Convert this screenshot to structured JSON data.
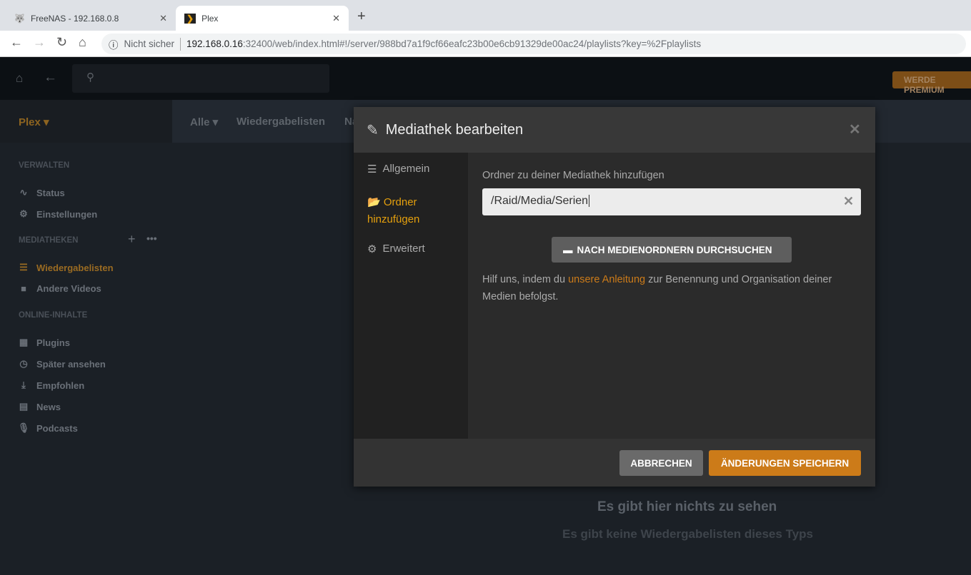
{
  "browser": {
    "tabs": [
      {
        "title": "FreeNAS - 192.168.0.8"
      },
      {
        "title": "Plex"
      }
    ],
    "security": "Nicht sicher",
    "url_host": "192.168.0.16",
    "url_rest": ":32400/web/index.html#!/server/988bd7a1f9cf66eafc23b00e6cb91329de00ac24/playlists?key=%2Fplaylists"
  },
  "topbar": {
    "premium": "WERDE PREMIUM"
  },
  "sidebar": {
    "server": "Plex ▾",
    "sections": {
      "manage": "VERWALTEN",
      "libraries": "MEDIATHEKEN",
      "online": "ONLINE-INHALTE"
    },
    "items": [
      {
        "label": "Status"
      },
      {
        "label": "Einstellungen"
      },
      {
        "label": "Wiedergabelisten"
      },
      {
        "label": "Andere Videos"
      },
      {
        "label": "Plugins"
      },
      {
        "label": "Später ansehen"
      },
      {
        "label": "Empfohlen"
      },
      {
        "label": "News"
      },
      {
        "label": "Podcasts"
      }
    ]
  },
  "subheader": {
    "filter": "Alle ▾",
    "title": "Wiedergabelisten",
    "partial": "Na"
  },
  "empty": {
    "title": "Es gibt hier nichts zu sehen",
    "subtitle": "Es gibt keine Wiedergabelisten dieses Typs"
  },
  "modal": {
    "title": "Mediathek bearbeiten",
    "nav": [
      {
        "label": "Allgemein"
      },
      {
        "label": "Ordner hinzufügen"
      },
      {
        "label": "Erweitert"
      }
    ],
    "folder_label": "Ordner zu deiner Mediathek hinzufügen",
    "folder_value": "/Raid/Media/Serien",
    "browse": "NACH MEDIENORDNERN DURCHSUCHEN",
    "help_pre": "Hilf uns, indem du ",
    "help_link": "unsere Anleitung",
    "help_post": " zur Benennung und Organisation deiner Medien befolgst.",
    "cancel": "ABBRECHEN",
    "save": "ÄNDERUNGEN SPEICHERN"
  }
}
